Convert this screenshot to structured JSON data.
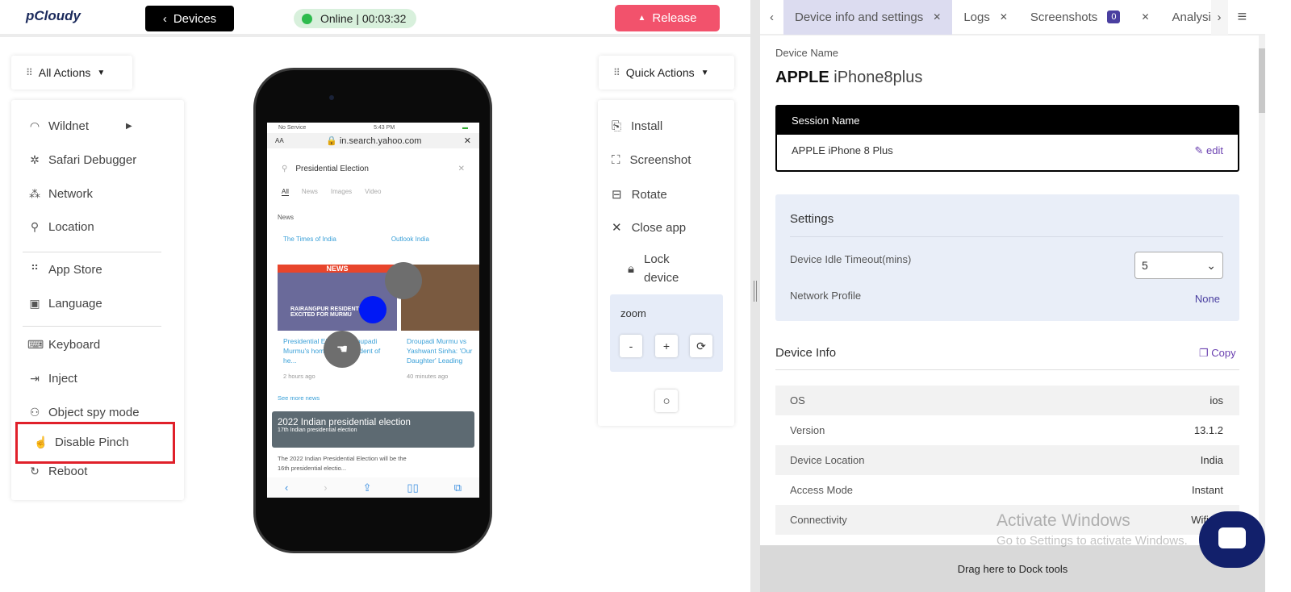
{
  "header": {
    "logo": "pCloudy",
    "devices_label": "Devices",
    "status": "Online | 00:03:32",
    "release_label": "Release",
    "status_color": "#2dbb4d",
    "release_color": "#f2526c"
  },
  "all_actions": {
    "label": "All Actions",
    "items": [
      {
        "label": "Wildnet",
        "icon": "wifi-icon"
      },
      {
        "label": "Safari Debugger",
        "icon": "bug-icon"
      },
      {
        "label": "Network",
        "icon": "network-icon"
      },
      {
        "label": "Location",
        "icon": "location-pin-icon"
      },
      {
        "label": "App Store",
        "icon": "app-store-icon"
      },
      {
        "label": "Language",
        "icon": "language-icon"
      },
      {
        "label": "Keyboard",
        "icon": "keyboard-icon"
      },
      {
        "label": "Inject",
        "icon": "inject-icon"
      },
      {
        "label": "Object spy mode",
        "icon": "object-spy-icon"
      },
      {
        "label": "Disable Pinch",
        "icon": "pinch-hand-icon"
      },
      {
        "label": "Reboot",
        "icon": "reboot-icon"
      }
    ]
  },
  "quick_actions": {
    "label": "Quick Actions",
    "items": [
      {
        "label": "Install"
      },
      {
        "label": "Screenshot"
      },
      {
        "label": "Rotate"
      },
      {
        "label": "Close app"
      },
      {
        "label": "Lock device"
      }
    ],
    "zoom": {
      "label": "zoom",
      "minus": "-",
      "plus": "+"
    }
  },
  "phone": {
    "carrier": "No Service",
    "time": "5:43 PM",
    "url": "in.search.yahoo.com",
    "aa": "AA",
    "query": "Presidential Election",
    "filters": [
      "All",
      "News",
      "Images",
      "Video"
    ],
    "news_heading": "News",
    "cards": [
      {
        "source": "The Times of India",
        "banner": "NEWS",
        "overlay": "RAIRANGPUR RESIDENTS EXCITED FOR MURMU",
        "title": "Presidential Election: Droupadi Murmu's hometown confident of he...",
        "age": "2 hours ago"
      },
      {
        "source": "Outlook India",
        "title": "Droupadi Murmu vs Yashwant Sinha: 'Our Daughter' Leading",
        "age": "40 minutes ago"
      }
    ],
    "see_more": "See more news",
    "wiki_title": "2022 Indian presidential election",
    "wiki_sub": "17th Indian presidential election",
    "wiki_text": "The 2022 Indian Presidential Election will be the 16th presidential electio..."
  },
  "right": {
    "tabs": [
      {
        "label": "Device info and settings"
      },
      {
        "label": "Logs"
      },
      {
        "label": "Screenshots",
        "badge": "0"
      },
      {
        "label": "Analysis"
      }
    ],
    "device_name_label": "Device Name",
    "brand": "APPLE",
    "model": "iPhone8plus",
    "session": {
      "header": "Session Name",
      "value": "APPLE iPhone 8 Plus",
      "edit": "edit"
    },
    "settings": {
      "title": "Settings",
      "idle_label": "Device Idle Timeout(mins)",
      "idle_value": "5",
      "network_label": "Network Profile",
      "network_value": "None"
    },
    "device_info": {
      "title": "Device Info",
      "copy": "Copy",
      "rows": [
        {
          "k": "OS",
          "v": "ios"
        },
        {
          "k": "Version",
          "v": "13.1.2"
        },
        {
          "k": "Device Location",
          "v": "India"
        },
        {
          "k": "Access Mode",
          "v": "Instant"
        },
        {
          "k": "Connectivity",
          "v": "Wifi on"
        }
      ]
    },
    "dock": "Drag here to Dock tools"
  },
  "watermark": {
    "line1": "Activate Windows",
    "line2": "Go to Settings to activate Windows."
  }
}
